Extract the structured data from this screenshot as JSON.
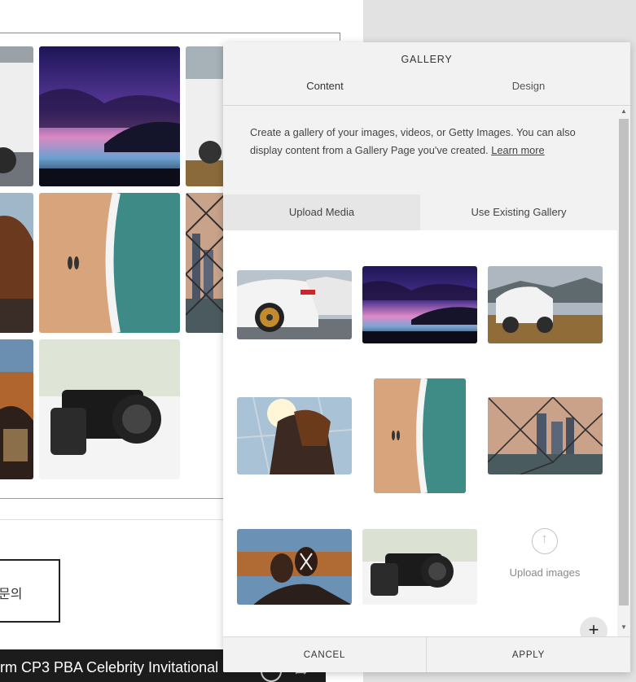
{
  "background_page": {
    "korean_box_text": "문의",
    "video_title": "rm CP3 PBA Celebrity Invitational"
  },
  "panel": {
    "title": "GALLERY",
    "tabs": [
      {
        "label": "Content",
        "active": true
      },
      {
        "label": "Design",
        "active": false
      }
    ],
    "description": "Create a gallery of your images, videos, or Getty Images. You can also display content from a Gallery Page you've created. ",
    "learn_more": "Learn more",
    "subtabs": [
      {
        "label": "Upload Media",
        "active": true
      },
      {
        "label": "Use Existing Gallery",
        "active": false
      }
    ],
    "gallery_items": [
      {
        "name": "white sports car"
      },
      {
        "name": "purple sunset beach"
      },
      {
        "name": "white suv in field"
      },
      {
        "name": "couple on rooftop"
      },
      {
        "name": "aerial beach"
      },
      {
        "name": "city through chain fence"
      },
      {
        "name": "face painted people"
      },
      {
        "name": "canon camera"
      }
    ],
    "upload_label": "Upload images",
    "footer": {
      "cancel": "CANCEL",
      "apply": "APPLY"
    }
  }
}
